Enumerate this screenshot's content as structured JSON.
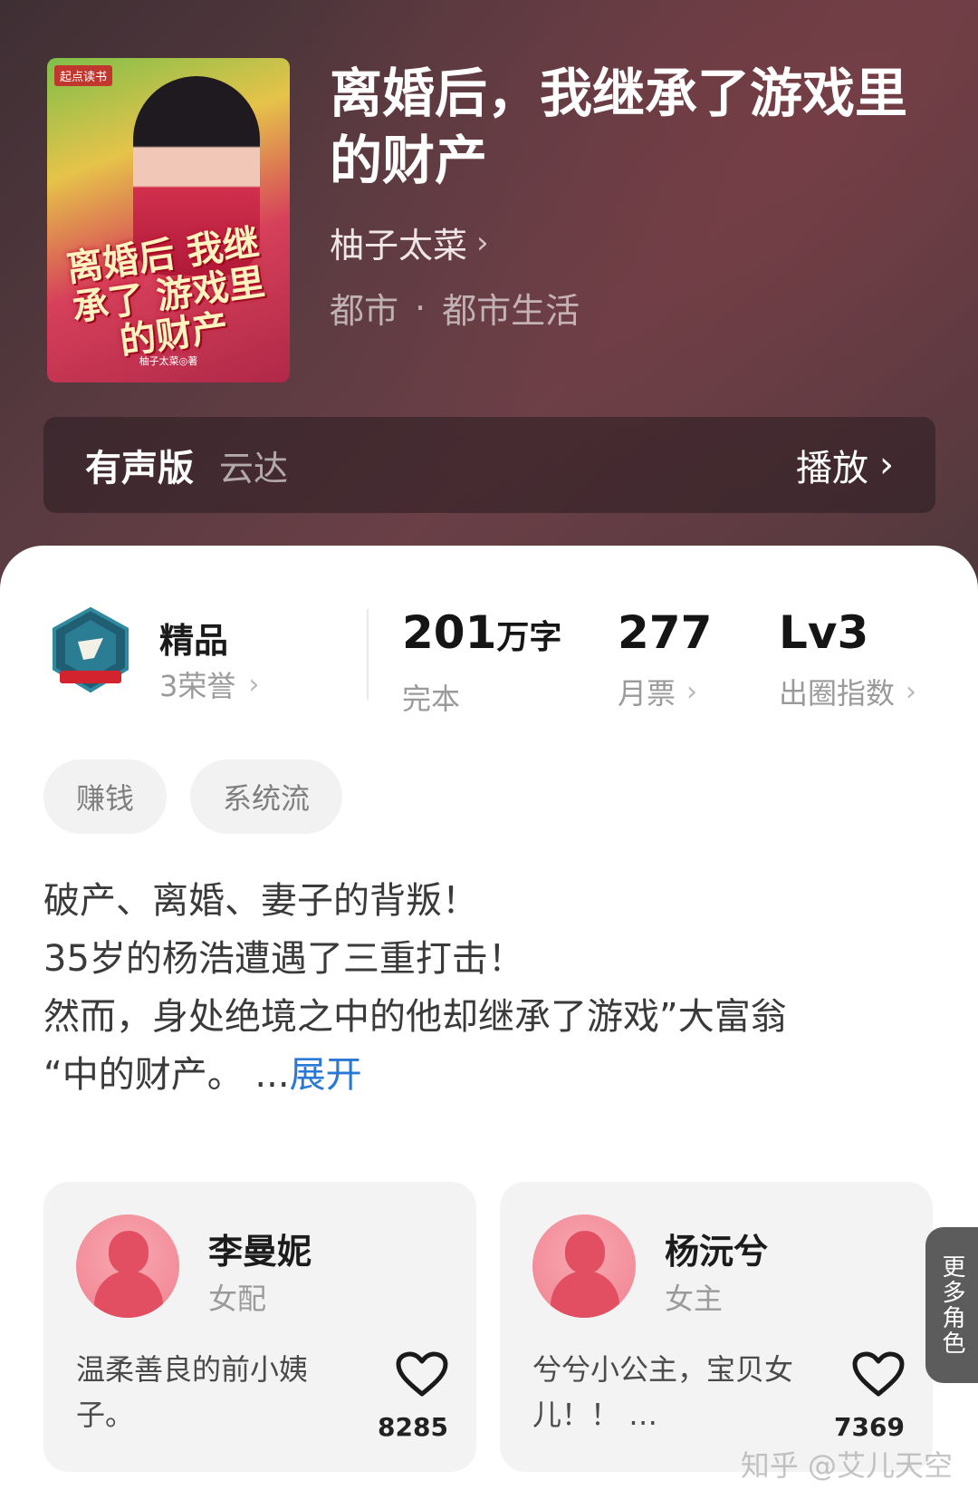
{
  "book": {
    "title": "离婚后，我继承了游戏里的财产",
    "author": "柚子太菜",
    "category": "都市",
    "subcategory": "都市生活",
    "separator": "·",
    "cover": {
      "badge": "起点读书",
      "title_art": "离婚后 我继承了 游戏里的财产",
      "author_art": "柚子太菜◎著"
    }
  },
  "audio": {
    "label": "有声版",
    "narrator": "云达",
    "play_label": "播放"
  },
  "stats": {
    "honor_title": "精品",
    "honor_sub": "3荣誉",
    "words_value": "201",
    "words_unit": "万字",
    "words_label": "完本",
    "votes_value": "277",
    "votes_label": "月票",
    "level_value": "Lv3",
    "level_label": "出圈指数"
  },
  "tags": [
    "赚钱",
    "系统流"
  ],
  "description": {
    "line1": "破产、离婚、妻子的背叛！",
    "line2": "35岁的杨浩遭遇了三重打击！",
    "line3": "然而，身处绝境之中的他却继承了游戏”大富翁",
    "line4": "“中的财产。 ...",
    "expand": "展开"
  },
  "characters": [
    {
      "name": "李曼妮",
      "role": "女配",
      "desc": "温柔善良的前小姨子。",
      "likes": "8285"
    },
    {
      "name": "杨沅兮",
      "role": "女主",
      "desc": "兮兮小公主，宝贝女儿！！ …",
      "likes": "7369"
    }
  ],
  "more_roles": "更多角色",
  "watermark": "知乎 @艾儿天空",
  "colors": {
    "accent_link": "#2a78d6",
    "avatar_pink": "#f0818e"
  }
}
